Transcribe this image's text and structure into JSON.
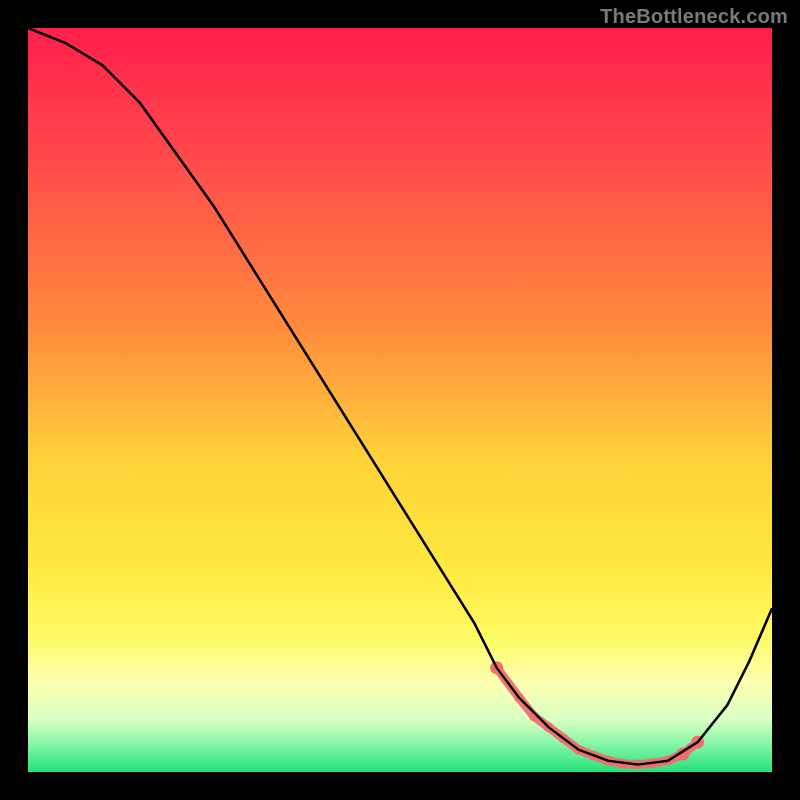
{
  "watermark": "TheBottleneck.com",
  "chart_data": {
    "type": "line",
    "title": "",
    "xlabel": "",
    "ylabel": "",
    "xlim": [
      0,
      100
    ],
    "ylim": [
      0,
      100
    ],
    "gradient_stops": [
      {
        "offset": 0,
        "color": "#ff1f4b"
      },
      {
        "offset": 18,
        "color": "#ff4b4b"
      },
      {
        "offset": 40,
        "color": "#ff8a3d"
      },
      {
        "offset": 58,
        "color": "#ffd23a"
      },
      {
        "offset": 72,
        "color": "#ffe83e"
      },
      {
        "offset": 82,
        "color": "#fffb66"
      },
      {
        "offset": 88,
        "color": "#fbffb0"
      },
      {
        "offset": 93,
        "color": "#d8ffc4"
      },
      {
        "offset": 96,
        "color": "#8cf7a8"
      },
      {
        "offset": 100,
        "color": "#23e27a"
      }
    ],
    "series": [
      {
        "name": "bottleneck-curve",
        "color": "#000000",
        "x": [
          0,
          5,
          10,
          15,
          20,
          25,
          30,
          35,
          40,
          45,
          50,
          55,
          60,
          63,
          66,
          70,
          74,
          78,
          82,
          86,
          90,
          94,
          97,
          100
        ],
        "y": [
          100,
          98,
          95,
          90,
          83,
          76,
          68,
          60,
          52,
          44,
          36,
          28,
          20,
          14,
          10,
          6,
          3,
          1.5,
          1,
          1.5,
          4,
          9,
          15,
          22
        ]
      }
    ],
    "highlight_band": {
      "name": "optimal-range",
      "color": "#ef6f6f",
      "x": [
        63,
        66,
        68,
        70,
        72,
        74,
        76,
        78,
        80,
        82,
        84,
        86,
        88,
        90
      ],
      "y": [
        14,
        10,
        7.5,
        6,
        4.5,
        3,
        2.2,
        1.5,
        1.1,
        1,
        1.2,
        1.5,
        2.4,
        4
      ]
    }
  }
}
